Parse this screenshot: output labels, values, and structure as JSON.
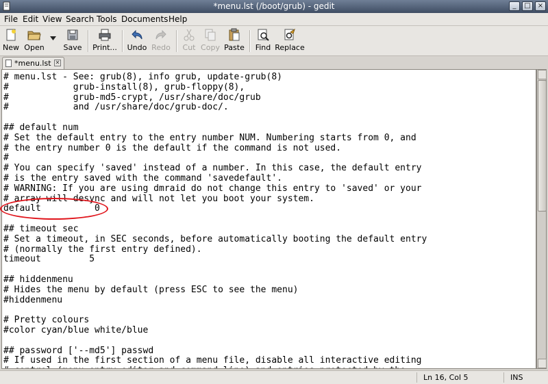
{
  "window": {
    "title": "*menu.lst (/boot/grub) - gedit",
    "controls": {
      "minimize": "_",
      "maximize": "□",
      "close": "×"
    }
  },
  "menubar": [
    "File",
    "Edit",
    "View",
    "Search",
    "Tools",
    "Documents",
    "Help"
  ],
  "toolbar": {
    "new": "New",
    "open": "Open",
    "save": "Save",
    "print": "Print...",
    "undo": "Undo",
    "redo": "Redo",
    "cut": "Cut",
    "copy": "Copy",
    "paste": "Paste",
    "find": "Find",
    "replace": "Replace"
  },
  "tab": {
    "label": "*menu.lst"
  },
  "editor": {
    "lines": [
      "# menu.lst - See: grub(8), info grub, update-grub(8)",
      "#            grub-install(8), grub-floppy(8),",
      "#            grub-md5-crypt, /usr/share/doc/grub",
      "#            and /usr/share/doc/grub-doc/.",
      "",
      "## default num",
      "# Set the default entry to the entry number NUM. Numbering starts from 0, and",
      "# the entry number 0 is the default if the command is not used.",
      "#",
      "# You can specify 'saved' instead of a number. In this case, the default entry",
      "# is the entry saved with the command 'savedefault'.",
      "# WARNING: If you are using dmraid do not change this entry to 'saved' or your",
      "# array will desync and will not let you boot your system.",
      "default          0",
      "",
      "## timeout sec",
      "# Set a timeout, in SEC seconds, before automatically booting the default entry",
      "# (normally the first entry defined).",
      "timeout         5",
      "",
      "## hiddenmenu",
      "# Hides the menu by default (press ESC to see the menu)",
      "#hiddenmenu",
      "",
      "# Pretty colours",
      "#color cyan/blue white/blue",
      "",
      "## password ['--md5'] passwd",
      "# If used in the first section of a menu file, disable all interactive editing",
      "# control (menu entry editor and command-line) and entries protected by the"
    ]
  },
  "statusbar": {
    "position": "Ln 16, Col 5",
    "mode": "INS"
  },
  "colors": {
    "highlight_ellipse": "#e0141b",
    "titlebar": "#4e5d75"
  }
}
